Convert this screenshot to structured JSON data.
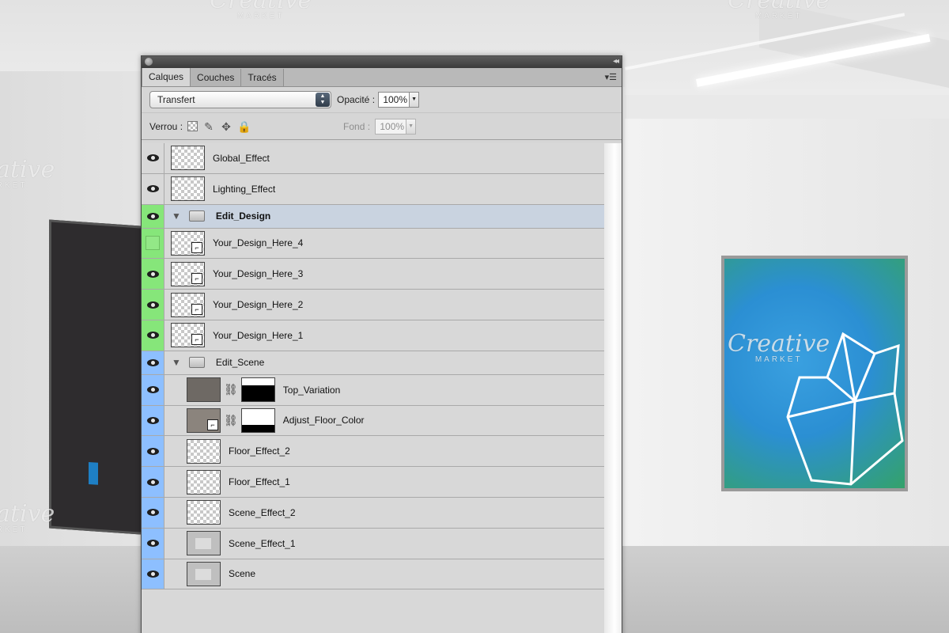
{
  "panel": {
    "tabs": [
      {
        "label": "Calques",
        "active": true
      },
      {
        "label": "Couches",
        "active": false
      },
      {
        "label": "Tracés",
        "active": false
      }
    ],
    "blend_mode": "Transfert",
    "opacity_label": "Opacité :",
    "opacity_value": "100%",
    "lock_label": "Verrou :",
    "fill_label": "Fond :",
    "fill_value": "100%"
  },
  "layers": [
    {
      "name": "Global_Effect",
      "visible": true,
      "color": "none",
      "type": "layer"
    },
    {
      "name": "Lighting_Effect",
      "visible": true,
      "color": "none",
      "type": "layer"
    },
    {
      "name": "Edit_Design",
      "visible": true,
      "color": "green",
      "type": "group"
    },
    {
      "name": "Your_Design_Here_4",
      "visible": false,
      "color": "green",
      "type": "smart"
    },
    {
      "name": "Your_Design_Here_3",
      "visible": true,
      "color": "green",
      "type": "smart"
    },
    {
      "name": "Your_Design_Here_2",
      "visible": true,
      "color": "green",
      "type": "smart"
    },
    {
      "name": "Your_Design_Here_1",
      "visible": true,
      "color": "green",
      "type": "smart"
    },
    {
      "name": "Edit_Scene",
      "visible": true,
      "color": "blue",
      "type": "group"
    },
    {
      "name": "Top_Variation",
      "visible": true,
      "color": "blue",
      "type": "adjust"
    },
    {
      "name": "Adjust_Floor_Color",
      "visible": true,
      "color": "blue",
      "type": "adjust"
    },
    {
      "name": "Floor_Effect_2",
      "visible": true,
      "color": "blue",
      "type": "layer"
    },
    {
      "name": "Floor_Effect_1",
      "visible": true,
      "color": "blue",
      "type": "layer"
    },
    {
      "name": "Scene_Effect_2",
      "visible": true,
      "color": "blue",
      "type": "layer"
    },
    {
      "name": "Scene_Effect_1",
      "visible": true,
      "color": "blue",
      "type": "layer"
    },
    {
      "name": "Scene",
      "visible": true,
      "color": "blue",
      "type": "layer"
    }
  ],
  "watermark": {
    "text": "Creative",
    "sub": "MARKET"
  },
  "colors": {
    "green_label": "#86e67a",
    "blue_label": "#8dbfff",
    "selected_row": "#c9d3e0"
  }
}
